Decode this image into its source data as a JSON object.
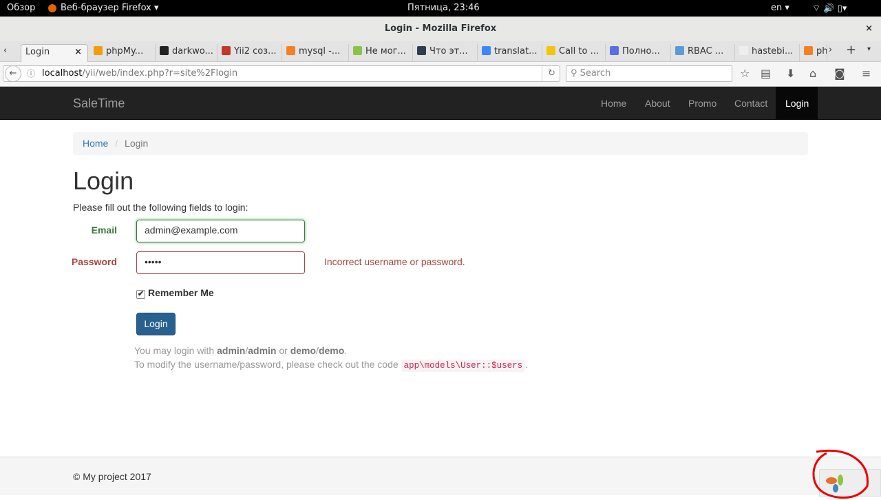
{
  "gnome": {
    "overview": "Обзор",
    "app": "Веб-браузер Firefox ▾",
    "clock": "Пятница, 23:46",
    "lang": "en ▾"
  },
  "window": {
    "title": "Login - Mozilla Firefox",
    "close": "×"
  },
  "tabs": [
    {
      "label": "Login",
      "color": "#f5f5f5"
    },
    {
      "label": "phpMy...",
      "color": "#f39c12"
    },
    {
      "label": "darkwo...",
      "color": "#222"
    },
    {
      "label": "Yii2 соз...",
      "color": "#c0392b"
    },
    {
      "label": "mysql -...",
      "color": "#f48024"
    },
    {
      "label": "Не мог...",
      "color": "#8bc34a"
    },
    {
      "label": "Что эт...",
      "color": "#2c3e50"
    },
    {
      "label": "translat...",
      "color": "#4285f4"
    },
    {
      "label": "Call to ...",
      "color": "#f1c40f"
    },
    {
      "label": "Полно...",
      "color": "#5b6ee1"
    },
    {
      "label": "RBAC ...",
      "color": "#5b9bd5"
    },
    {
      "label": "hastebi...",
      "color": "#eee"
    },
    {
      "label": "ph",
      "color": "#f48024"
    }
  ],
  "url": {
    "host": "localhost",
    "path": "/yii/web/index.php?r=site%2Flogin"
  },
  "search_placeholder": "Search",
  "site": {
    "brand": "SaleTime",
    "nav": [
      "Home",
      "About",
      "Promo",
      "Contact",
      "Login"
    ]
  },
  "breadcrumb": {
    "home": "Home",
    "sep": "/",
    "current": "Login"
  },
  "page": {
    "title": "Login",
    "intro": "Please fill out the following fields to login:"
  },
  "form": {
    "email_label": "Email",
    "email_value": "admin@example.com",
    "password_label": "Password",
    "password_value": "•••••",
    "password_error": "Incorrect username or password.",
    "remember_label": "Remember Me",
    "submit": "Login"
  },
  "hint": {
    "l1a": "You may login with ",
    "u1": "admin",
    "s": "/",
    "p1": "admin",
    "or": " or ",
    "u2": "demo",
    "p2": "demo",
    "dot": ".",
    "l2": "To modify the username/password, please check out the code ",
    "code": "app\\models\\User::$users"
  },
  "footer": {
    "copyright": "© My project 2017"
  }
}
